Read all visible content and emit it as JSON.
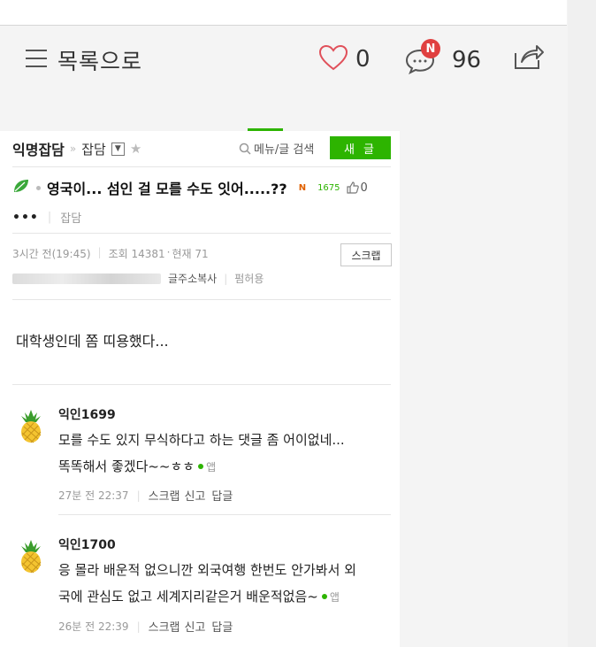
{
  "topbar": {
    "list_label": "목록으로",
    "like_count": "0",
    "comment_badge": "N",
    "comment_count": "96"
  },
  "board": {
    "name": "익명잡담",
    "category": "잡담",
    "search_label": "메뉴/글 검색",
    "new_post_label": "새 글"
  },
  "post": {
    "title": "영국이... 섬인 걸 모를 수도 잇어.....??",
    "new_mark": "N",
    "views_small": "1675",
    "likes": "0",
    "author": "•••",
    "category": "잡담",
    "time": "3시간 전(19:45)",
    "hits": "조회 14381",
    "current": "현재 71",
    "scrap_label": "스크랩",
    "copy_url_label": "글주소복사",
    "share_permission": "펌허용",
    "body": "대학생인데 쫌 띠용했다..."
  },
  "comments": [
    {
      "author": "익인1699",
      "line1": "모를 수도 있지 무식하다고 하는 댓글 좀 어이없네...",
      "line2": "똑똑해서 좋겠다~~ㅎㅎ",
      "app": "앱",
      "time": "27분 전 22:37",
      "scrap": "스크랩",
      "report": "신고",
      "reply": "답글"
    },
    {
      "author": "익인1700",
      "line1": "응 몰라 배운적 없으니깐 외국여행 한번도 안가봐서 외",
      "line2": "국에 관심도 없고 세계지리같은거 배운적없음~",
      "app": "앱",
      "time": "26분 전 22:39",
      "scrap": "스크랩",
      "report": "신고",
      "reply": "답글"
    }
  ],
  "colors": {
    "accent": "#2db400",
    "badge": "#e04040",
    "heart": "#e0505a"
  }
}
